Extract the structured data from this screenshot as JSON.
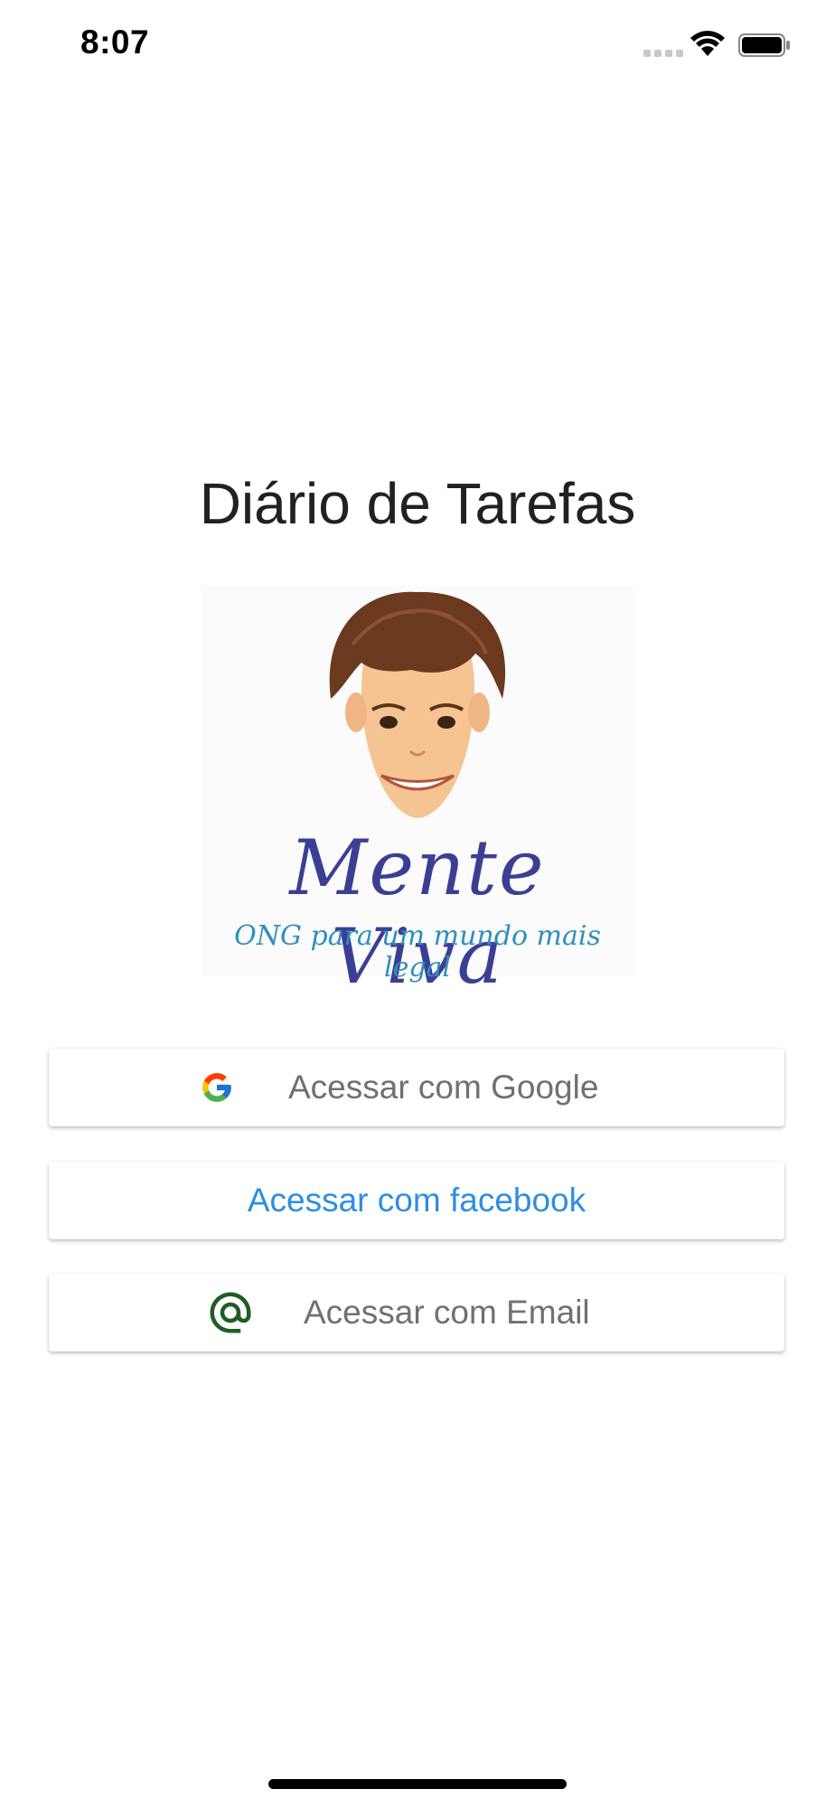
{
  "status_bar": {
    "time": "8:07",
    "icons": [
      "cellular-signal-icon",
      "wifi-icon",
      "battery-icon"
    ]
  },
  "page": {
    "title": "Diário de Tarefas"
  },
  "logo": {
    "wordmark": "Mente Viva",
    "tagline": "ONG para um mundo mais legal"
  },
  "buttons": {
    "google": {
      "label": "Acessar com Google",
      "icon": "google-icon"
    },
    "facebook": {
      "label": "Acessar com facebook"
    },
    "email": {
      "label": "Acessar com Email",
      "icon": "at-sign-icon"
    }
  },
  "colors": {
    "facebook_text": "#2d8ee3",
    "button_text": "#707070",
    "email_icon": "#1e5e22",
    "logo_wordmark": "#3b3f94",
    "logo_tagline": "#2f8fbd"
  }
}
